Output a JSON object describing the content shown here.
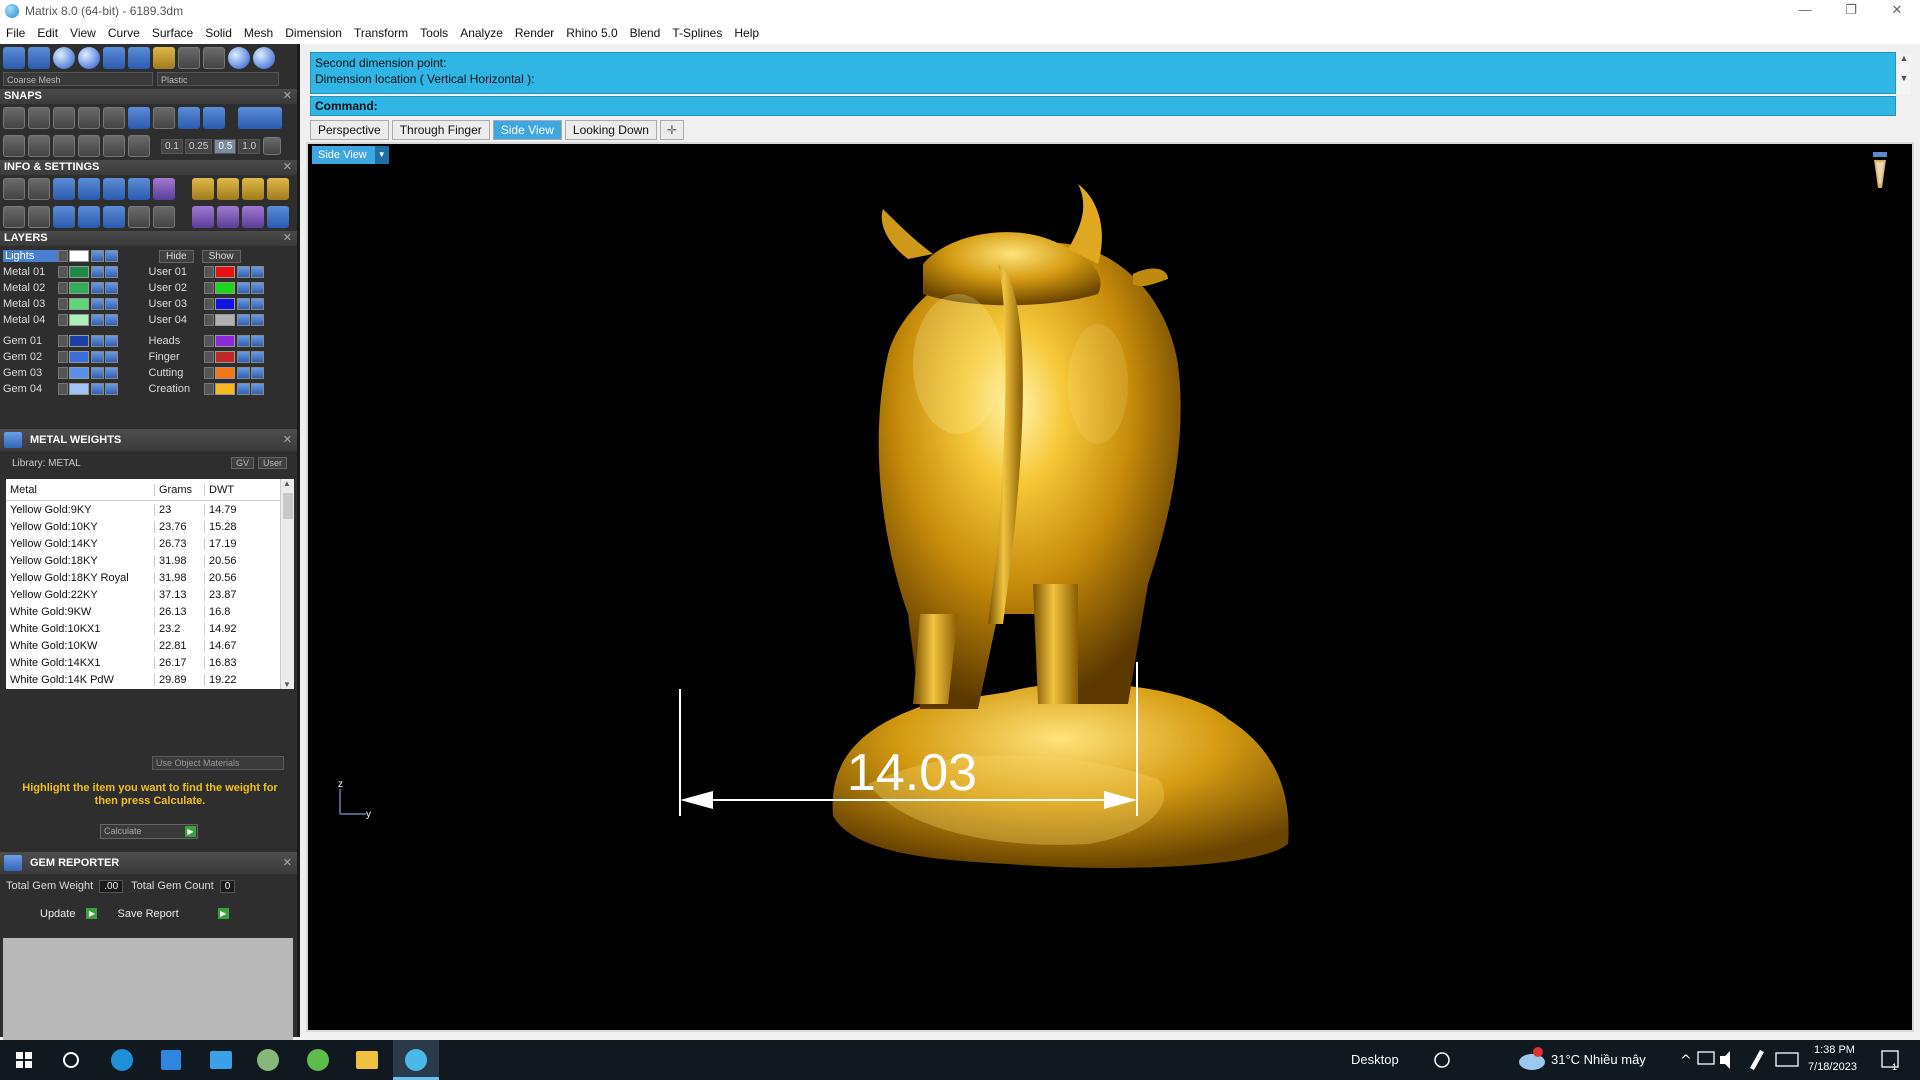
{
  "window": {
    "title": "Matrix 8.0 (64-bit) - 6189.3dm",
    "controls": [
      "—",
      "❐",
      "✕"
    ]
  },
  "menu": [
    "File",
    "Edit",
    "View",
    "Curve",
    "Surface",
    "Solid",
    "Mesh",
    "Dimension",
    "Transform",
    "Tools",
    "Analyze",
    "Render",
    "Rhino 5.0",
    "Blend",
    "T-Splines",
    "Help"
  ],
  "left": {
    "mesh_dropdown": "Coarse Mesh",
    "material_dropdown": "Plastic",
    "snaps": {
      "title": "SNAPS",
      "values": [
        "0.1",
        "0.25",
        "0.5",
        "1.0"
      ]
    },
    "info": {
      "title": "INFO & SETTINGS"
    },
    "layers": {
      "title": "LAYERS",
      "hide": "Hide",
      "show": "Show",
      "lights": "Lights",
      "left_groups": [
        [
          {
            "name": "Metal 01",
            "color": "#1d8a4a"
          },
          {
            "name": "Metal 02",
            "color": "#2fae5a"
          },
          {
            "name": "Metal 03",
            "color": "#5ed67a"
          },
          {
            "name": "Metal 04",
            "color": "#a8f0b4"
          }
        ],
        [
          {
            "name": "Gem 01",
            "color": "#1a3fa8"
          },
          {
            "name": "Gem 02",
            "color": "#3a6ed8"
          },
          {
            "name": "Gem 03",
            "color": "#5a90ea"
          },
          {
            "name": "Gem 04",
            "color": "#a0c4f4"
          }
        ]
      ],
      "right_groups": [
        [
          {
            "name": "User 01",
            "color": "#e81010"
          },
          {
            "name": "User 02",
            "color": "#18d818"
          },
          {
            "name": "User 03",
            "color": "#1010e8"
          },
          {
            "name": "User 04",
            "color": "#b0b0b0"
          }
        ],
        [
          {
            "name": "Heads",
            "color": "#8a2ad8"
          },
          {
            "name": "Finger",
            "color": "#c02828"
          },
          {
            "name": "Cutting",
            "color": "#f07818"
          },
          {
            "name": "Creation",
            "color": "#f8b820"
          }
        ]
      ]
    },
    "metal_weights": {
      "title": "METAL WEIGHTS",
      "library": "Library: METAL",
      "gv": "GV",
      "user": "User",
      "headers": [
        "Metal",
        "Grams",
        "DWT"
      ],
      "rows": [
        [
          "Yellow Gold:9KY",
          "23",
          "14.79"
        ],
        [
          "Yellow Gold:10KY",
          "23.76",
          "15.28"
        ],
        [
          "Yellow Gold:14KY",
          "26.73",
          "17.19"
        ],
        [
          "Yellow Gold:18KY",
          "31.98",
          "20.56"
        ],
        [
          "Yellow Gold:18KY Royal",
          "31.98",
          "20.56"
        ],
        [
          "Yellow Gold:22KY",
          "37.13",
          "23.87"
        ],
        [
          "White Gold:9KW",
          "26.13",
          "16.8"
        ],
        [
          "White Gold:10KX1",
          "23.2",
          "14.92"
        ],
        [
          "White Gold:10KW",
          "22.81",
          "14.67"
        ],
        [
          "White Gold:14KX1",
          "26.17",
          "16.83"
        ],
        [
          "White Gold:14K PdW",
          "29.89",
          "19.22"
        ]
      ],
      "use_object": "Use Object Materials",
      "message": "Highlight the item you want to find the weight for then press Calculate.",
      "calculate": "Calculate"
    },
    "gem_reporter": {
      "title": "GEM REPORTER",
      "total_weight_label": "Total Gem Weight",
      "total_weight": ".00",
      "total_count_label": "Total Gem Count",
      "total_count": "0",
      "update": "Update",
      "save_report": "Save Report"
    }
  },
  "command": {
    "history": [
      "Second dimension point:",
      "Dimension location ( Vertical  Horizontal ):"
    ],
    "prompt": "Command:"
  },
  "tabs": [
    "Perspective",
    "Through Finger",
    "Side View",
    "Looking Down"
  ],
  "active_tab": "Side View",
  "viewport": {
    "label": "Side View",
    "dimension": "14.03",
    "axis_z": "z",
    "axis_y": "y"
  },
  "taskbar": {
    "desktop": "Desktop",
    "weather": "31°C  Nhiều mây",
    "time": "1:38 PM",
    "date": "7/18/2023",
    "notif": "1"
  }
}
